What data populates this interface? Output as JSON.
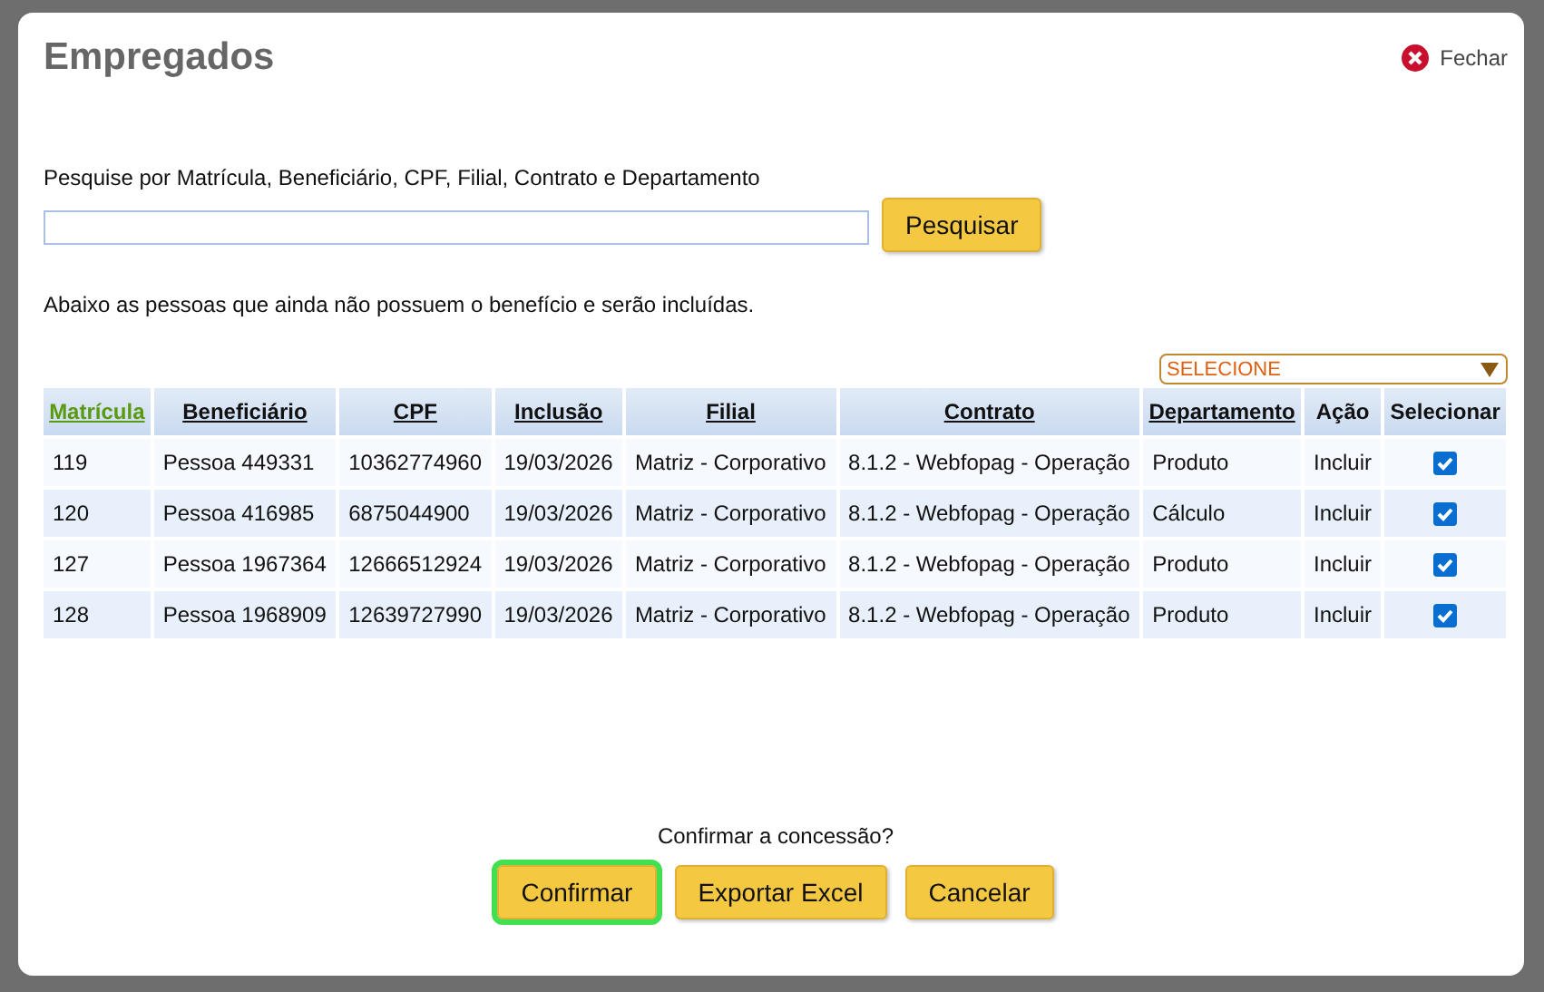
{
  "dialog": {
    "title": "Empregados",
    "close_label": "Fechar"
  },
  "search": {
    "label": "Pesquise por Matrícula, Beneficiário, CPF, Filial, Contrato e Departamento",
    "button": "Pesquisar"
  },
  "info": "Abaixo as pessoas que ainda não possuem o benefício e serão incluídas.",
  "department_filter": {
    "value": "SELECIONE"
  },
  "table": {
    "columns": [
      {
        "label": "Matrícula",
        "kind": "link",
        "sorted": true
      },
      {
        "label": "Beneficiário",
        "kind": "link",
        "sorted": false
      },
      {
        "label": "CPF",
        "kind": "link",
        "sorted": false
      },
      {
        "label": "Inclusão",
        "kind": "link",
        "sorted": false
      },
      {
        "label": "Filial",
        "kind": "link",
        "sorted": false
      },
      {
        "label": "Contrato",
        "kind": "link",
        "sorted": false
      },
      {
        "label": "Departamento",
        "kind": "link",
        "sorted": false
      },
      {
        "label": "Ação",
        "kind": "text",
        "sorted": false
      },
      {
        "label": "Selecionar",
        "kind": "text",
        "sorted": false
      }
    ],
    "rows": [
      {
        "cells": [
          "119",
          "Pessoa 449331",
          "10362774960",
          "19/03/2026",
          "Matriz - Corporativo",
          "8.1.2 - Webfopag - Operação",
          "Produto",
          "Incluir"
        ],
        "checked": true
      },
      {
        "cells": [
          "120",
          "Pessoa 416985",
          "6875044900",
          "19/03/2026",
          "Matriz - Corporativo",
          "8.1.2 - Webfopag - Operação",
          "Cálculo",
          "Incluir"
        ],
        "checked": true
      },
      {
        "cells": [
          "127",
          "Pessoa 1967364",
          "12666512924",
          "19/03/2026",
          "Matriz - Corporativo",
          "8.1.2 - Webfopag - Operação",
          "Produto",
          "Incluir"
        ],
        "checked": true
      },
      {
        "cells": [
          "128",
          "Pessoa 1968909",
          "12639727990",
          "19/03/2026",
          "Matriz - Corporativo",
          "8.1.2 - Webfopag - Operação",
          "Produto",
          "Incluir"
        ],
        "checked": true
      }
    ]
  },
  "confirm_question": "Confirmar a concessão?",
  "buttons": [
    {
      "label": "Confirmar",
      "focused": true
    },
    {
      "label": "Exportar Excel",
      "focused": false
    },
    {
      "label": "Cancelar",
      "focused": false
    }
  ]
}
